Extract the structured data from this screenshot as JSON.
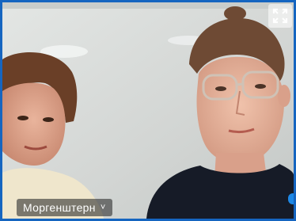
{
  "participant": {
    "name": "Моргенштерн",
    "chevron": "˅"
  },
  "icons": {
    "fullscreen": "expand-icon",
    "dropdown": "chevron-down-icon"
  },
  "colors": {
    "tile_border": "#1565c0",
    "name_tag_bg": "#3a3a3a"
  }
}
